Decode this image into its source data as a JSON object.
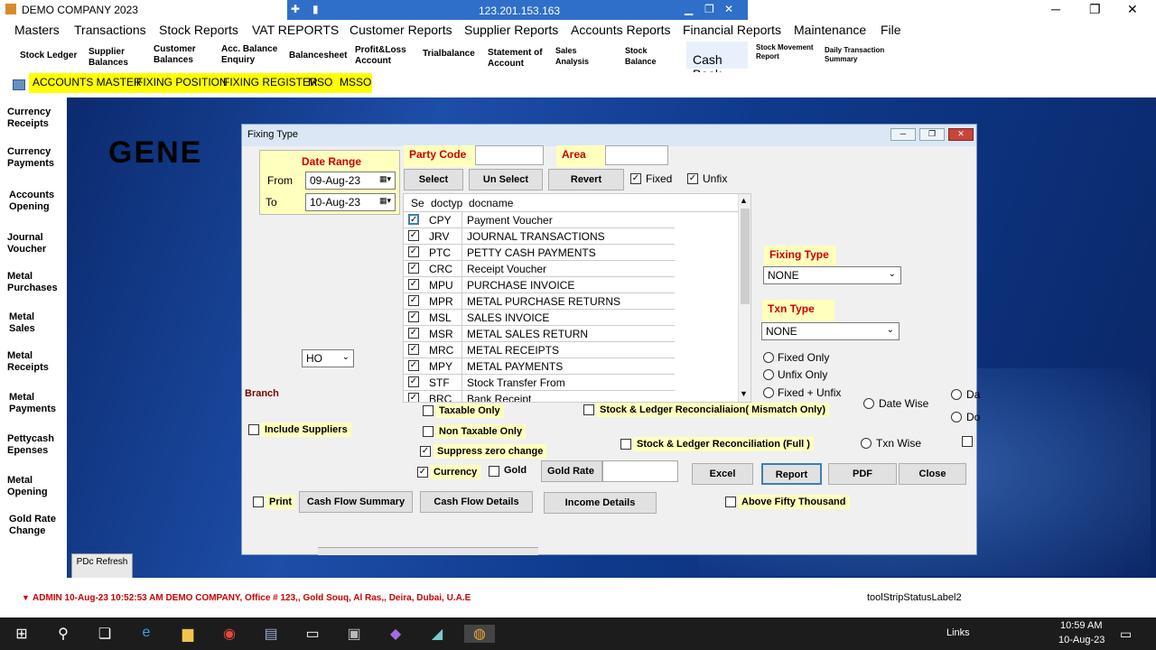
{
  "window": {
    "title": "DEMO COMPANY 2023"
  },
  "rdp": {
    "address": "123.201.153.163"
  },
  "menu": [
    "Masters",
    "Transactions",
    "Stock Reports",
    "VAT REPORTS",
    "Customer Reports",
    "Supplier Reports",
    "Accounts Reports",
    "Financial Reports",
    "Maintenance",
    "File"
  ],
  "toolbar": [
    "Stock Ledger",
    "Supplier Balances",
    "Customer Balances",
    "Acc. Balance Enquiry",
    "Balancesheet",
    "Profit&Loss Account",
    "Trialbalance",
    "Statement of Account",
    "Sales Analysis",
    "Stock Balance",
    "Cash Book",
    "Stock Movement Report",
    "Daily Transaction Summary"
  ],
  "quick": [
    "ACCOUNTS MASTER",
    "FIXING POSITION",
    "FIXING REGISTER",
    "MSO",
    "MSSO"
  ],
  "sidebar": [
    "Currency Receipts",
    "Currency Payments",
    "Accounts Opening",
    "Journal Voucher",
    "Metal Purchases",
    "Metal Sales",
    "Metal Receipts",
    "Metal Payments",
    "Pettycash Epenses",
    "Metal Opening",
    "Gold Rate Change"
  ],
  "pdc_button": "PDc Refresh",
  "background_text": "GENE",
  "dialog": {
    "title": "Fixing Type",
    "date_range": "Date Range",
    "from_label": "From",
    "from_value": "09-Aug-23",
    "to_label": "To",
    "to_value": "10-Aug-23",
    "party_code": "Party Code",
    "area": "Area",
    "select": "Select",
    "unselect": "Un Select",
    "revert": "Revert",
    "fixed": "Fixed",
    "unfix": "Unfix",
    "grid_headers": [
      "Se",
      "doctyp",
      "docname"
    ],
    "grid_rows": [
      {
        "code": "CPY",
        "name": "Payment Voucher"
      },
      {
        "code": "JRV",
        "name": "JOURNAL TRANSACTIONS"
      },
      {
        "code": "PTC",
        "name": "PETTY CASH PAYMENTS"
      },
      {
        "code": "CRC",
        "name": "Receipt Voucher"
      },
      {
        "code": "MPU",
        "name": "PURCHASE INVOICE"
      },
      {
        "code": "MPR",
        "name": "METAL PURCHASE RETURNS"
      },
      {
        "code": "MSL",
        "name": "SALES INVOICE"
      },
      {
        "code": "MSR",
        "name": "METAL SALES RETURN"
      },
      {
        "code": "MRC",
        "name": "METAL RECEIPTS"
      },
      {
        "code": "MPY",
        "name": "METAL PAYMENTS"
      },
      {
        "code": "STF",
        "name": "Stock Transfer From"
      },
      {
        "code": "BRC",
        "name": "Bank Receipt"
      }
    ],
    "fixing_type_label": "Fixing Type",
    "fixing_type_value": "NONE",
    "txn_type_label": "Txn Type",
    "txn_type_value": "NONE",
    "fixed_only": "Fixed Only",
    "unfix_only": "Unfix Only",
    "fixed_unfix": "Fixed + Unfix",
    "date_wise": "Date Wise",
    "txn_wise": "Txn Wise",
    "da": "Da",
    "do": "Do",
    "branch_value": "HO",
    "branch_label": "Branch",
    "taxable_only": "Taxable Only",
    "non_taxable_only": "Non Taxable Only",
    "suppress_zero": "Suppress zero change",
    "currency": "Currency",
    "gold": "Gold",
    "gold_rate": "Gold Rate",
    "include_suppliers": "Include Suppliers",
    "stock_mismatch": "Stock & Ledger Reconcialiaion( Mismatch Only)",
    "stock_full": "Stock & Ledger Reconciliation (Full )",
    "excel": "Excel",
    "report": "Report",
    "pdf": "PDF",
    "close": "Close",
    "print": "Print",
    "cash_flow_summary": "Cash Flow Summary",
    "cash_flow_details": "Cash Flow Details",
    "income_details": "Income Details",
    "above_fifty": "Above Fifty Thousand"
  },
  "status": {
    "text": "ADMIN  10-Aug-23 10:52:53 AM  DEMO COMPANY, Office # 123,, Gold Souq, Al Ras,, Deira, Dubai, U.A.E",
    "toolstrip": "toolStripStatusLabel2"
  },
  "taskbar": {
    "time": "10:59 AM",
    "date": "10-Aug-23",
    "links": "Links"
  }
}
